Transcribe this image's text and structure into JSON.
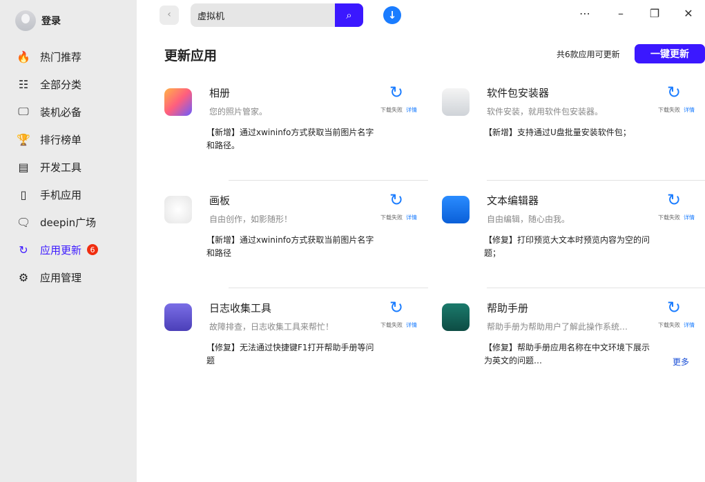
{
  "sidebar": {
    "login": "登录",
    "items": [
      {
        "label": "热门推荐",
        "icon": "fire-icon"
      },
      {
        "label": "全部分类",
        "icon": "grid-icon"
      },
      {
        "label": "装机必备",
        "icon": "monitor-icon"
      },
      {
        "label": "排行榜单",
        "icon": "trophy-icon"
      },
      {
        "label": "开发工具",
        "icon": "terminal-icon"
      },
      {
        "label": "手机应用",
        "icon": "phone-icon"
      },
      {
        "label": "deepin广场",
        "icon": "chat-icon"
      },
      {
        "label": "应用更新",
        "icon": "refresh-icon",
        "badge": "6"
      },
      {
        "label": "应用管理",
        "icon": "gear-icon"
      }
    ]
  },
  "search": {
    "value": "虚拟机"
  },
  "main": {
    "title": "更新应用",
    "count": "共6款应用可更新",
    "update_all": "一键更新",
    "more": "更多",
    "status_fail": "下载失败",
    "detail": "详情",
    "apps": [
      {
        "name": "相册",
        "desc": "您的照片管家。",
        "note": "【新增】通过xwininfo方式获取当前图片名字和路径。"
      },
      {
        "name": "软件包安装器",
        "desc": "软件安装，就用软件包安装器。",
        "note": "【新增】支持通过U盘批量安装软件包；"
      },
      {
        "name": "画板",
        "desc": "自由创作，如影随形！",
        "note": "【新增】通过xwininfo方式获取当前图片名字和路径"
      },
      {
        "name": "文本编辑器",
        "desc": "自由编辑，随心由我。",
        "note": "【修复】打印预览大文本时预览内容为空的问题；"
      },
      {
        "name": "日志收集工具",
        "desc": "故障排查，日志收集工具来帮忙！",
        "note": "【修复】无法通过快捷键F1打开帮助手册等问题"
      },
      {
        "name": "帮助手册",
        "desc": "帮助手册为帮助用户了解此操作系统…",
        "note": "【修复】帮助手册应用名称在中文环境下展示为英文的问题…"
      }
    ]
  }
}
